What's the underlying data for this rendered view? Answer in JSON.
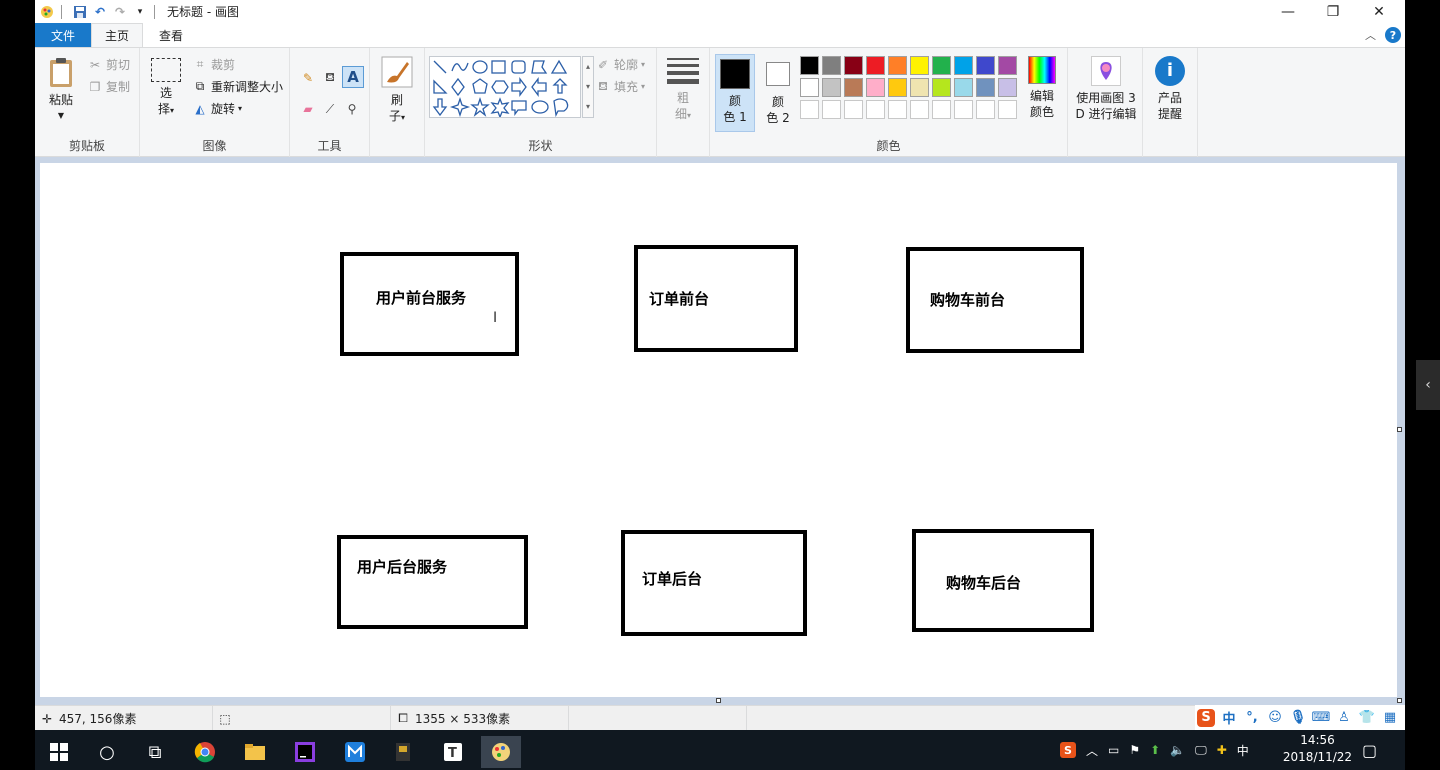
{
  "window": {
    "title": "无标题 - 画图",
    "minimize": "—",
    "maximize": "❐",
    "close": "✕"
  },
  "tabs": {
    "file": "文件",
    "home": "主页",
    "view": "查看"
  },
  "ribbon": {
    "clipboard": {
      "paste": "粘贴",
      "cut": "剪切",
      "copy": "复制",
      "label": "剪贴板"
    },
    "image": {
      "select_line1": "选",
      "select_line2": "择",
      "crop": "裁剪",
      "resize": "重新调整大小",
      "rotate": "旋转",
      "label": "图像"
    },
    "tools": {
      "label": "工具"
    },
    "brushes": {
      "line1": "刷",
      "line2": "子"
    },
    "shapes": {
      "outline": "轮廓",
      "fill": "填充",
      "label": "形状"
    },
    "size": {
      "line1": "粗",
      "line2": "细"
    },
    "colors": {
      "color1_line1": "颜",
      "color1_line2": "色 1",
      "color2_line1": "颜",
      "color2_line2": "色 2",
      "edit_line1": "编辑",
      "edit_line2": "颜色",
      "label": "颜色",
      "color1_value": "#000000",
      "color2_value": "#ffffff",
      "palette_row1": [
        "#000000",
        "#7f7f7f",
        "#880015",
        "#ed1c24",
        "#ff7f27",
        "#fff200",
        "#22b14c",
        "#00a2e8",
        "#3f48cc",
        "#a349a4"
      ],
      "palette_row2": [
        "#ffffff",
        "#c3c3c3",
        "#b97a57",
        "#ffaec9",
        "#ffc90e",
        "#efe4b0",
        "#b5e61d",
        "#99d9ea",
        "#7092be",
        "#c8bfe7"
      ]
    },
    "paint3d": {
      "line1": "使用画图 3",
      "line2": "D 进行编辑"
    },
    "product": {
      "line1": "产品",
      "line2": "提醒"
    }
  },
  "canvas": {
    "boxes": [
      {
        "label": "用户前台服务"
      },
      {
        "label": "订单前台"
      },
      {
        "label": "购物车前台"
      },
      {
        "label": "用户后台服务"
      },
      {
        "label": "订单后台"
      },
      {
        "label": "购物车后台"
      }
    ]
  },
  "status": {
    "cursor_pos": "457, 156像素",
    "canvas_size": "1355 × 533像素"
  },
  "ime": {
    "mode": "中",
    "punct": "°,"
  },
  "taskbar": {
    "time": "14:56",
    "date": "2018/11/22",
    "ime_lang": "中"
  }
}
